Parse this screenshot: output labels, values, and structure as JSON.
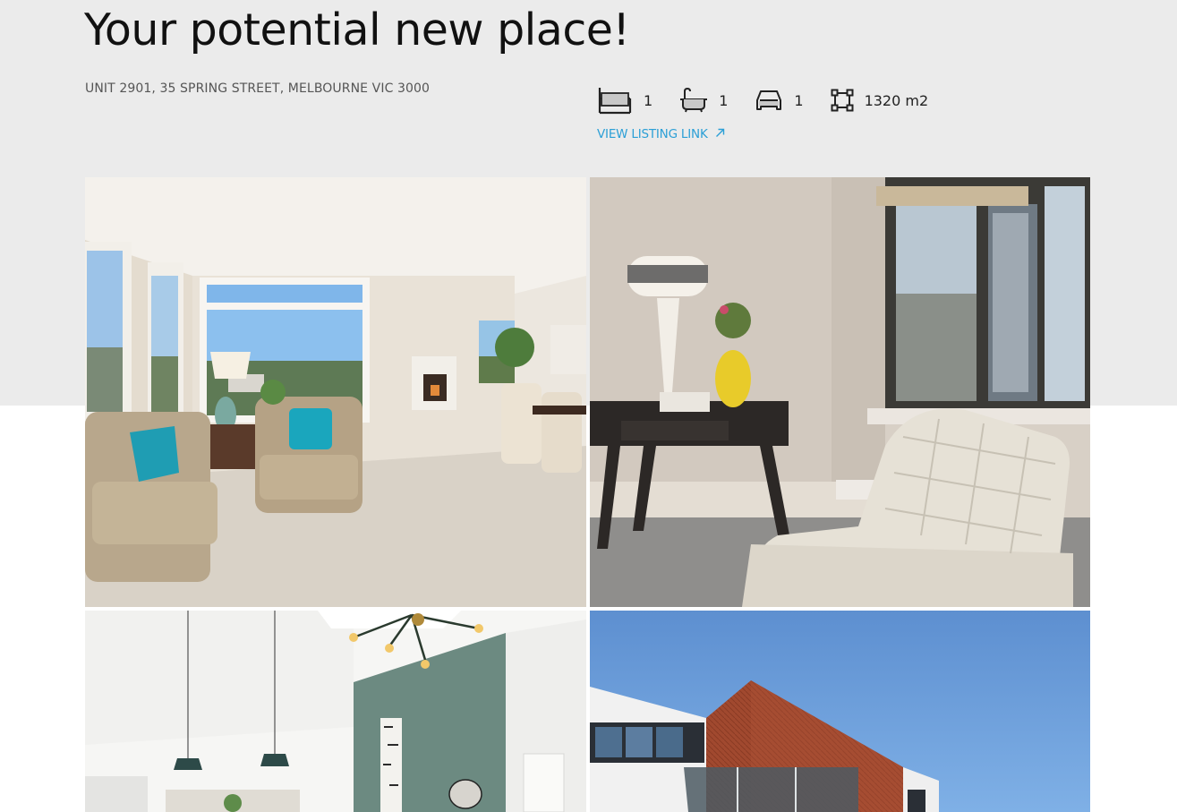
{
  "listing": {
    "title": "Your potential new place!",
    "address": "UNIT 2901, 35 SPRING STREET, MELBOURNE VIC 3000",
    "link_label": "VIEW LISTING LINK",
    "features": [
      {
        "icon": "bed-icon",
        "value": "1"
      },
      {
        "icon": "bath-icon",
        "value": "1"
      },
      {
        "icon": "car-icon",
        "value": "1"
      },
      {
        "icon": "area-icon",
        "value": "1320 m2"
      }
    ]
  },
  "colors": {
    "hero_background": "#ebebeb",
    "link": "#2b9fd6",
    "text": "#111111"
  },
  "gallery": {
    "photos": [
      {
        "subject": "living room with armchairs and large windows"
      },
      {
        "subject": "corner with side table, lamp, and white leather chair"
      },
      {
        "subject": "room with pendant lights and green accent wall"
      },
      {
        "subject": "modern building exterior with copper facade"
      }
    ]
  }
}
